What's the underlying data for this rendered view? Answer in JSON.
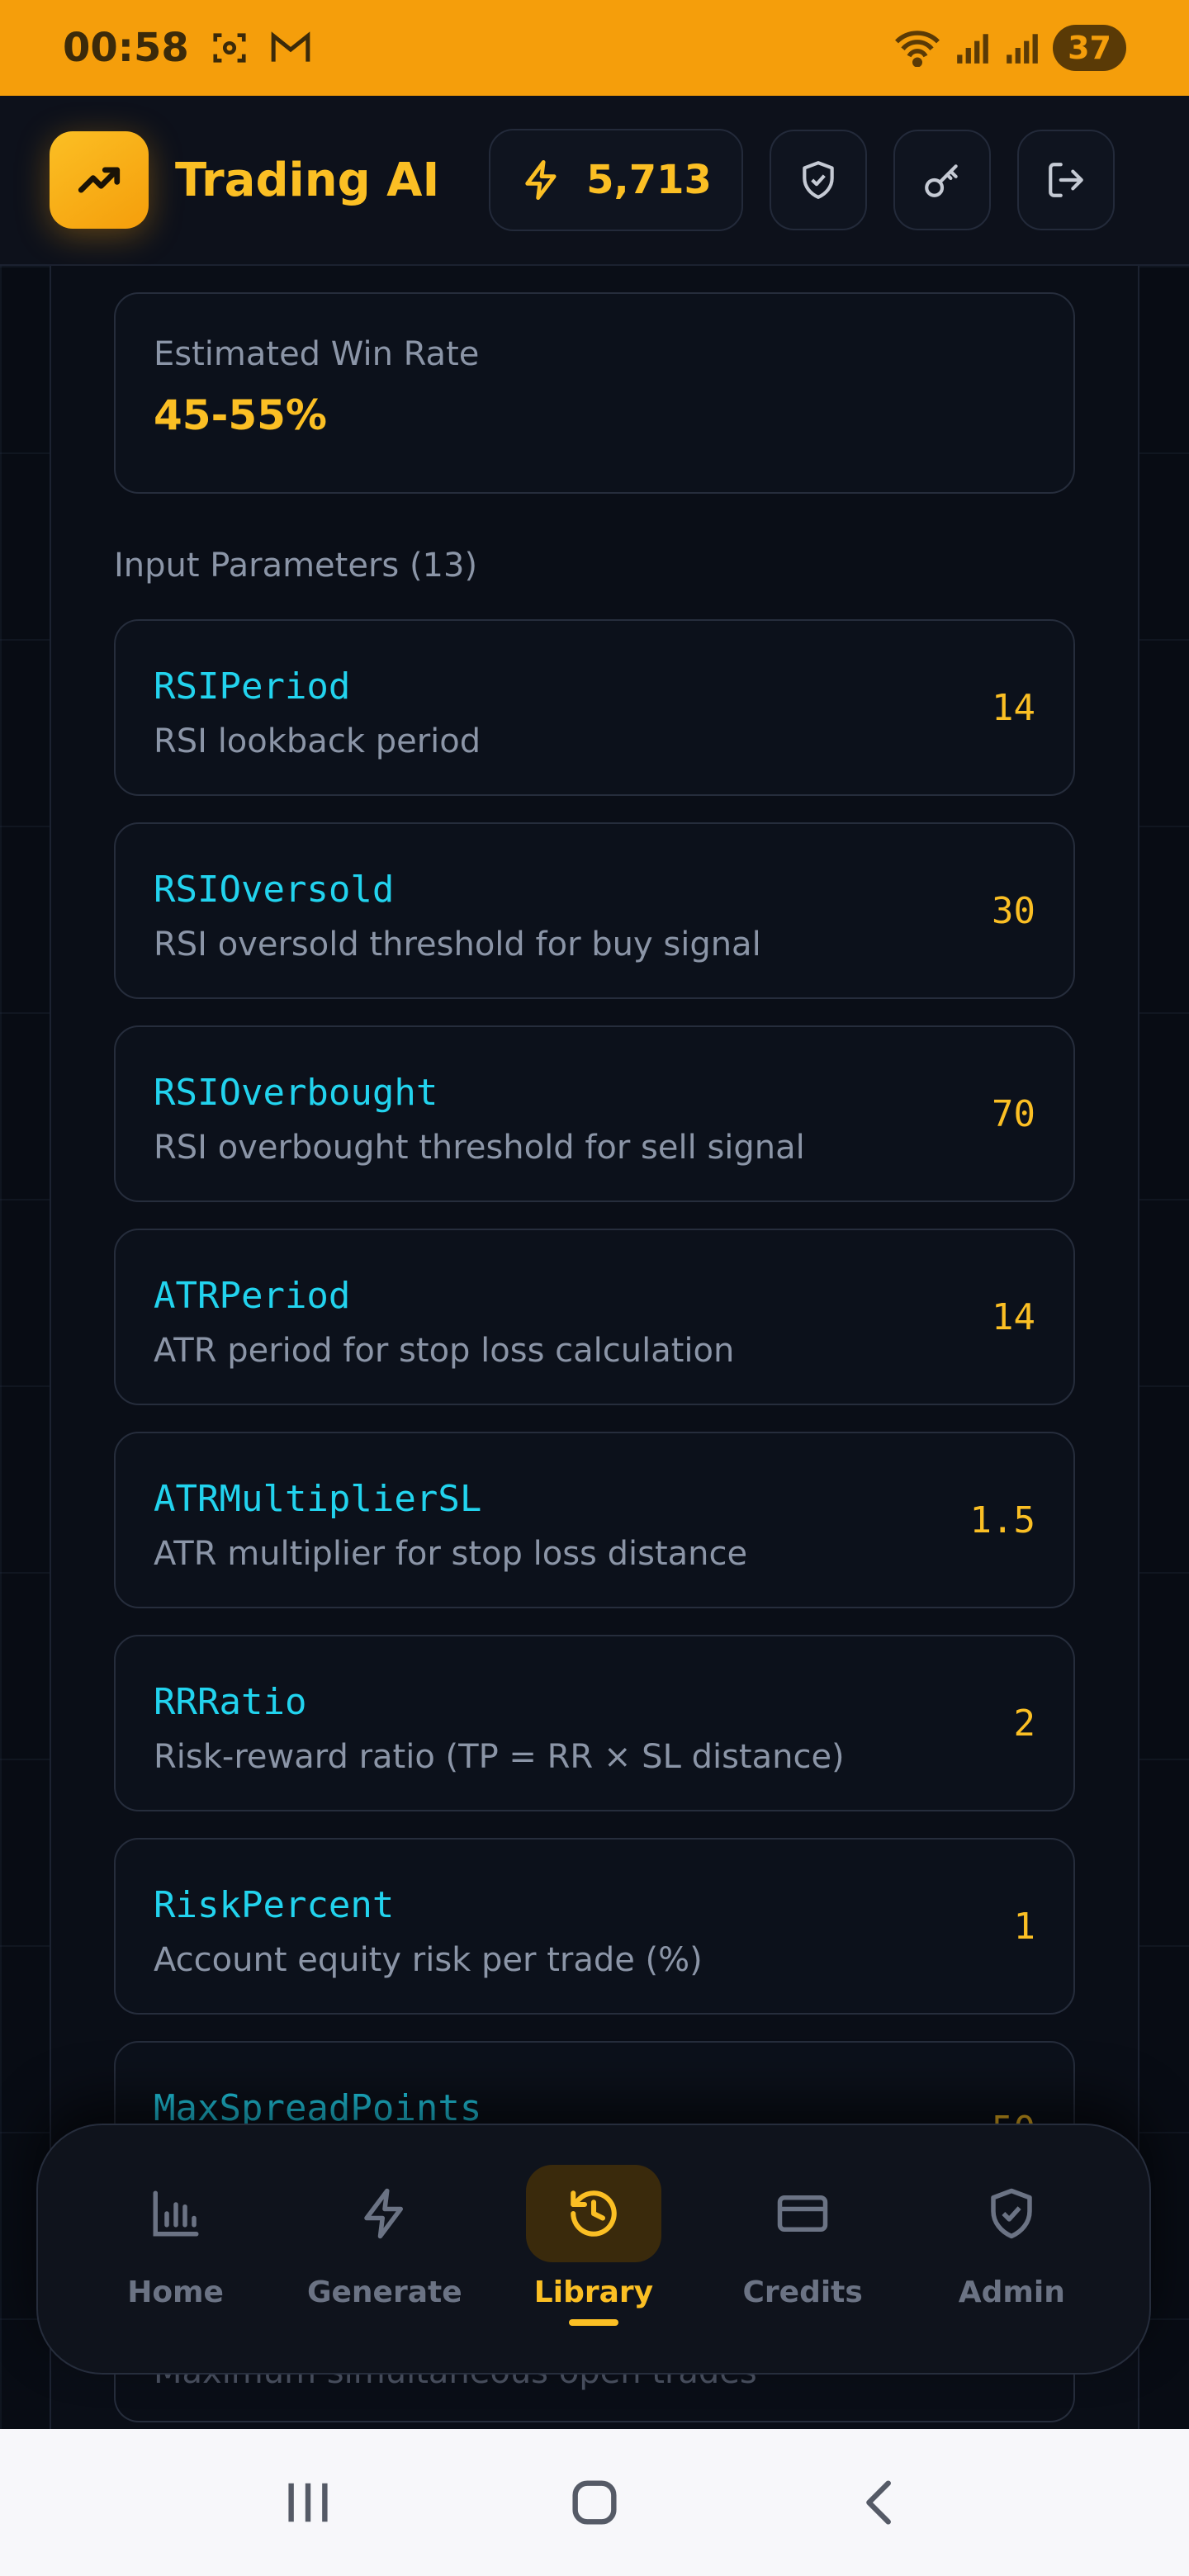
{
  "status_bar": {
    "time": "00:58",
    "battery": "37"
  },
  "header": {
    "title": "Trading AI",
    "credits": "5,713"
  },
  "win_rate": {
    "label": "Estimated Win Rate",
    "value": "45-55%"
  },
  "params": {
    "heading": "Input Parameters (13)",
    "items": [
      {
        "name": "RSIPeriod",
        "desc": "RSI lookback period",
        "value": "14"
      },
      {
        "name": "RSIOversold",
        "desc": "RSI oversold threshold for buy signal",
        "value": "30"
      },
      {
        "name": "RSIOverbought",
        "desc": "RSI overbought threshold for sell signal",
        "value": "70"
      },
      {
        "name": "ATRPeriod",
        "desc": "ATR period for stop loss calculation",
        "value": "14"
      },
      {
        "name": "ATRMultiplierSL",
        "desc": "ATR multiplier for stop loss distance",
        "value": "1.5"
      },
      {
        "name": "RRRatio",
        "desc": "Risk-reward ratio (TP = RR × SL distance)",
        "value": "2"
      },
      {
        "name": "RiskPercent",
        "desc": "Account equity risk per trade (%)",
        "value": "1"
      },
      {
        "name": "MaxSpreadPoints",
        "desc": "",
        "value": "50"
      }
    ],
    "peek_desc": "Maximum simultaneous open trades"
  },
  "nav": {
    "items": [
      {
        "label": "Home",
        "icon": "bar-chart-icon"
      },
      {
        "label": "Generate",
        "icon": "lightning-icon"
      },
      {
        "label": "Library",
        "icon": "history-icon"
      },
      {
        "label": "Credits",
        "icon": "credit-card-icon"
      },
      {
        "label": "Admin",
        "icon": "shield-check-icon"
      }
    ],
    "active": "Library"
  },
  "colors": {
    "accent": "#fbbf24",
    "param_name": "#22d3ee",
    "status_bar": "#f59e0b",
    "background": "#080c14"
  }
}
